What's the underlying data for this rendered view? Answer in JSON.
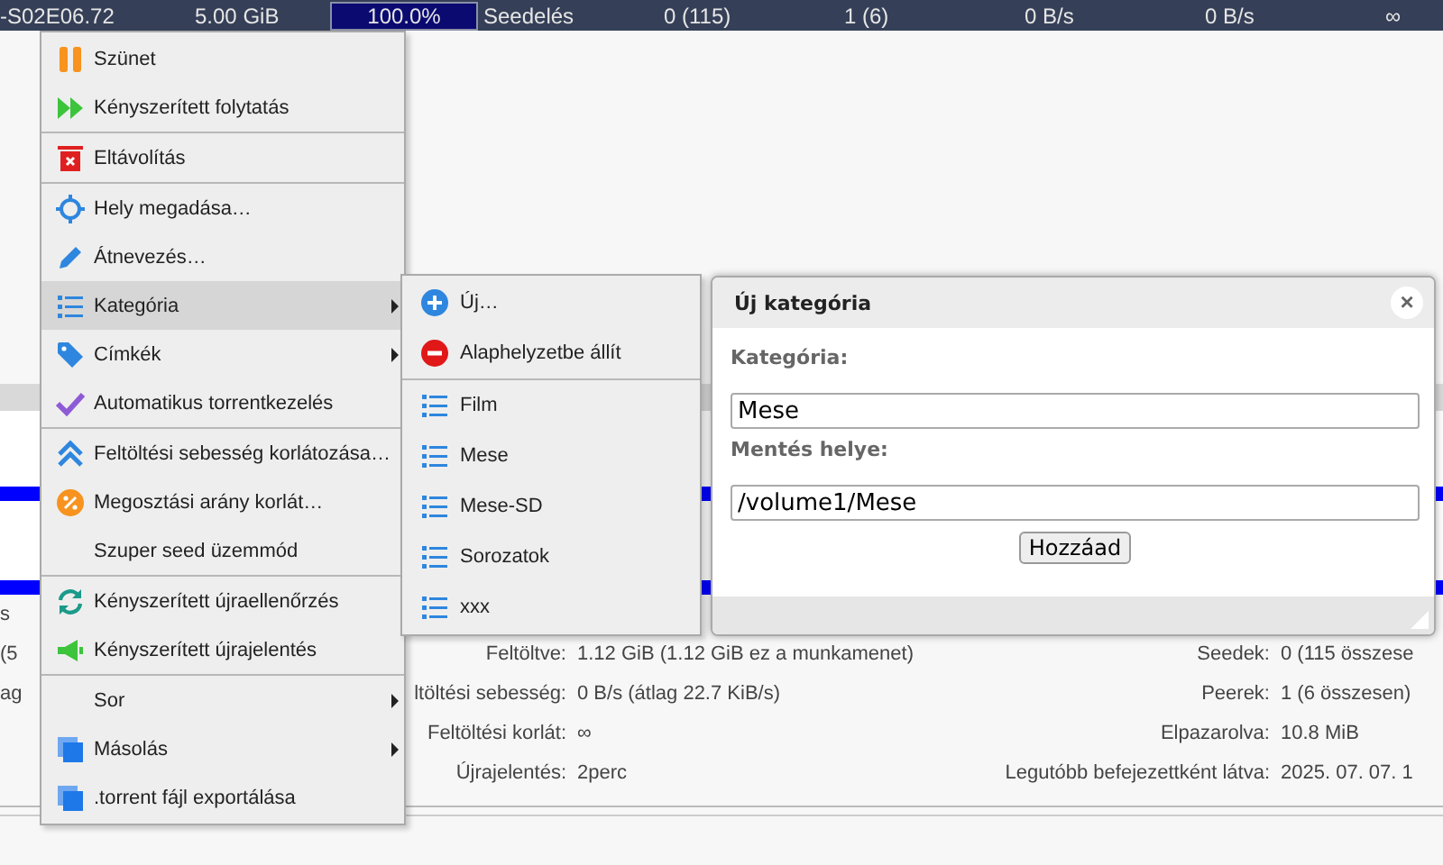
{
  "torrent_row": {
    "name": "-S02E06.72",
    "size": "5.00 GiB",
    "progress": {
      "label": "100.0%",
      "level": 1
    },
    "status": "Seedelés",
    "seeds": "0 (115)",
    "peers": "1 (6)",
    "down_speed": "0 B/s",
    "up_speed": "0 B/s",
    "eta": "∞"
  },
  "details": {
    "left_fragments": [
      "s",
      "(5",
      "ag"
    ],
    "rows": [
      {
        "label": "Feltöltve:",
        "value": "1.12 GiB (1.12 GiB ez a munkamenet)",
        "label_2": "Seedek:",
        "value_2": "0 (115 összese"
      },
      {
        "label": "ltöltési sebesség:",
        "value": "0 B/s (átlag 22.7 KiB/s)",
        "label_2": "Peerek:",
        "value_2": "1 (6 összesen)"
      },
      {
        "label": "Feltöltési korlát:",
        "value": "∞",
        "label_2": "Elpazarolva:",
        "value_2": "10.8 MiB"
      },
      {
        "label": "Újrajelentés:",
        "value": "2perc",
        "label_2": "Legutóbb befejezettként látva:",
        "value_2": "2025. 07. 07. 1"
      }
    ]
  },
  "context_menu": [
    {
      "kind": "item",
      "label": "Szünet",
      "submenu": false,
      "selected": false
    },
    {
      "kind": "item",
      "label": "Kényszerített folytatás",
      "submenu": false,
      "selected": false
    },
    {
      "kind": "separator"
    },
    {
      "kind": "item",
      "label": "Eltávolítás",
      "submenu": false,
      "selected": false
    },
    {
      "kind": "separator"
    },
    {
      "kind": "item",
      "label": "Hely megadása…",
      "submenu": false,
      "selected": false
    },
    {
      "kind": "item",
      "label": "Átnevezés…",
      "submenu": false,
      "selected": false
    },
    {
      "kind": "item",
      "label": "Kategória",
      "submenu": true,
      "selected": true
    },
    {
      "kind": "item",
      "label": "Címkék",
      "submenu": true,
      "selected": false
    },
    {
      "kind": "item",
      "label": "Automatikus torrentkezelés",
      "submenu": false,
      "selected": false
    },
    {
      "kind": "separator"
    },
    {
      "kind": "item",
      "label": "Feltöltési sebesség korlátozása…",
      "submenu": false,
      "selected": false
    },
    {
      "kind": "item",
      "label": "Megosztási arány korlát…",
      "submenu": false,
      "selected": false
    },
    {
      "kind": "item",
      "label": "Szuper seed üzemmód",
      "submenu": false,
      "selected": false
    },
    {
      "kind": "separator"
    },
    {
      "kind": "item",
      "label": "Kényszerített újraellenőrzés",
      "submenu": false,
      "selected": false
    },
    {
      "kind": "item",
      "label": "Kényszerített újrajelentés",
      "submenu": false,
      "selected": false
    },
    {
      "kind": "separator"
    },
    {
      "kind": "item",
      "label": "Sor",
      "submenu": true,
      "selected": false
    },
    {
      "kind": "item",
      "label": "Másolás",
      "submenu": true,
      "selected": false
    },
    {
      "kind": "item",
      "label": ".torrent fájl exportálása",
      "submenu": false,
      "selected": false
    }
  ],
  "category_submenu": [
    {
      "kind": "item",
      "label": "Új…",
      "submenu": false,
      "selected": false
    },
    {
      "kind": "item",
      "label": "Alaphelyzetbe állít",
      "submenu": false,
      "selected": false
    },
    {
      "kind": "separator"
    },
    {
      "kind": "item",
      "label": "Film",
      "submenu": false,
      "selected": false
    },
    {
      "kind": "item",
      "label": "Mese",
      "submenu": false,
      "selected": false
    },
    {
      "kind": "item",
      "label": "Mese-SD",
      "submenu": false,
      "selected": false
    },
    {
      "kind": "item",
      "label": "Sorozatok",
      "submenu": false,
      "selected": false
    },
    {
      "kind": "item",
      "label": "xxx",
      "submenu": false,
      "selected": false
    }
  ],
  "dialog": {
    "title": "Új kategória",
    "close": "×",
    "category_label": "Kategória:",
    "category_value": "Mese",
    "path_label": "Mentés helye:",
    "path_value": "/volume1/Mese",
    "button": "Hozzáad"
  }
}
